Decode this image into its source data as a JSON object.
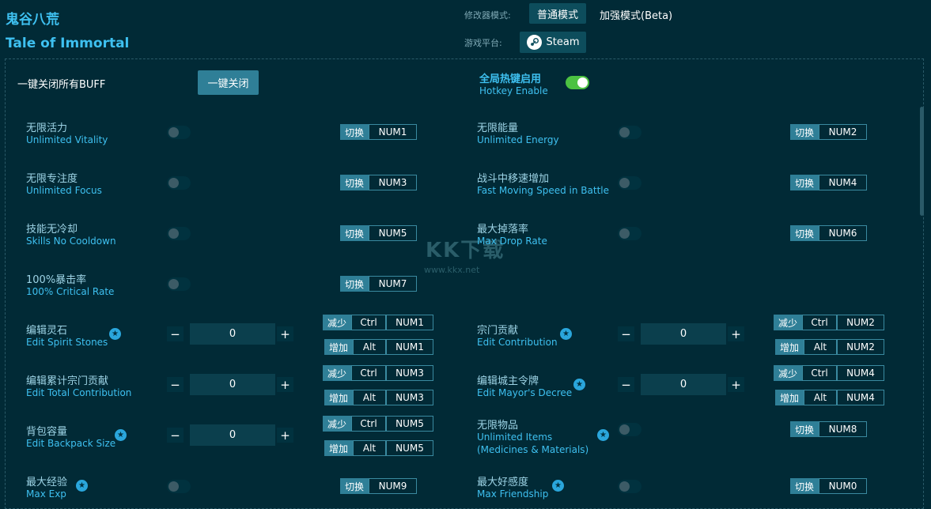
{
  "header": {
    "title_cn": "鬼谷八荒",
    "title_en": "Tale of Immortal",
    "mode_label": "修改器模式:",
    "mode_normal": "普通模式",
    "mode_enhanced": "加强模式(Beta)",
    "platform_label": "游戏平台:",
    "platform": "Steam"
  },
  "global": {
    "close_all_label": "一键关闭所有BUFF",
    "close_all_button": "一键关闭",
    "hotkey_cn": "全局热键启用",
    "hotkey_en": "Hotkey Enable",
    "hotkey_enabled": true
  },
  "toggle_tag": "切换",
  "dec_tag": "减少",
  "inc_tag": "增加",
  "watermark": "KK下载",
  "watermark_url": "www.kkx.net",
  "toggles": [
    {
      "cn": "无限活力",
      "en": "Unlimited Vitality",
      "key": "NUM1",
      "star": false,
      "on": false
    },
    {
      "cn": "无限能量",
      "en": "Unlimited Energy",
      "key": "NUM2",
      "star": false,
      "on": false
    },
    {
      "cn": "无限专注度",
      "en": "Unlimited Focus",
      "key": "NUM3",
      "star": false,
      "on": false
    },
    {
      "cn": "战斗中移速增加",
      "en": "Fast Moving Speed in Battle",
      "key": "NUM4",
      "star": false,
      "on": false
    },
    {
      "cn": "技能无冷却",
      "en": "Skills No Cooldown",
      "key": "NUM5",
      "star": false,
      "on": false
    },
    {
      "cn": "最大掉落率",
      "en": "Max Drop Rate",
      "key": "NUM6",
      "star": false,
      "on": false
    },
    {
      "cn": "100%暴击率",
      "en": "100% Critical Rate",
      "key": "NUM7",
      "star": false,
      "on": false
    },
    {
      "cn": "无限物品",
      "en": "Unlimited Items",
      "en2": "(Medicines & Materials)",
      "key": "NUM8",
      "star": true,
      "on": false
    },
    {
      "cn": "最大经验",
      "en": "Max Exp",
      "key": "NUM9",
      "star": true,
      "on": false
    },
    {
      "cn": "最大好感度",
      "en": "Max Friendship",
      "key": "NUM0",
      "star": true,
      "on": false
    }
  ],
  "numeric": [
    {
      "cn": "编辑灵石",
      "en": "Edit Spirit Stones",
      "value": "0",
      "dec_mod": "Ctrl",
      "dec_key": "NUM1",
      "inc_mod": "Alt",
      "inc_key": "NUM1",
      "minus": "−",
      "plus": "+"
    },
    {
      "cn": "宗门贡献",
      "en": "Edit Contribution",
      "value": "0",
      "dec_mod": "Ctrl",
      "dec_key": "NUM2",
      "inc_mod": "Alt",
      "inc_key": "NUM2",
      "minus": "−",
      "plus": "+"
    },
    {
      "cn": "编辑累计宗门贡献",
      "en": "Edit Total Contribution",
      "value": "0",
      "dec_mod": "Ctrl",
      "dec_key": "NUM3",
      "inc_mod": "Alt",
      "inc_key": "NUM3",
      "minus": "−",
      "plus": "+"
    },
    {
      "cn": "编辑城主令牌",
      "en": "Edit Mayor's Decree",
      "value": "0",
      "dec_mod": "Ctrl",
      "dec_key": "NUM4",
      "inc_mod": "Alt",
      "inc_key": "NUM4",
      "minus": "−",
      "plus": "+"
    },
    {
      "cn": "背包容量",
      "en": "Edit Backpack Size",
      "value": "0",
      "dec_mod": "Ctrl",
      "dec_key": "NUM5",
      "inc_mod": "Alt",
      "inc_key": "NUM5",
      "minus": "−",
      "plus": "+"
    }
  ]
}
